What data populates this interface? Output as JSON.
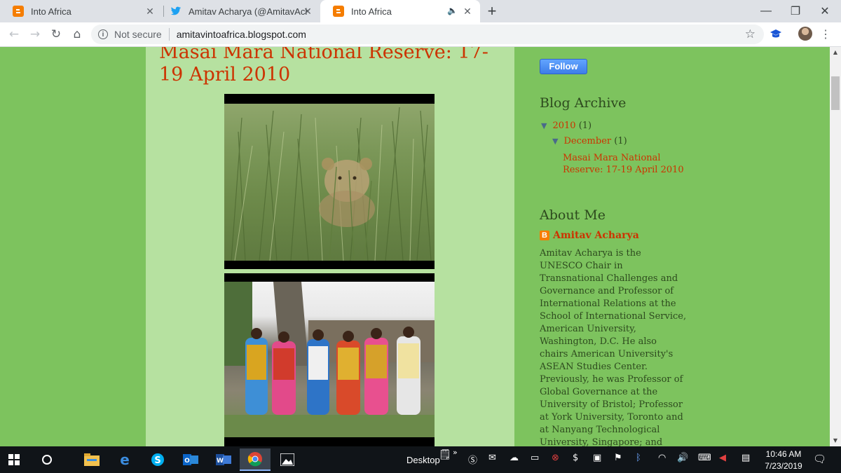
{
  "browser": {
    "tabs": [
      {
        "title": "Into Africa",
        "active": false
      },
      {
        "title": "Amitav Acharya (@AmitavAchary",
        "active": false
      },
      {
        "title": "Into Africa",
        "active": true
      }
    ],
    "new_tab_label": "+",
    "security_label": "Not secure",
    "url": "amitavintoafrica.blogspot.com"
  },
  "post": {
    "title": "Masai Mara National Reserve: 17-19 April 2010"
  },
  "sidebar": {
    "follow_label": "Follow",
    "archive_heading": "Blog Archive",
    "archive_year": "2010",
    "archive_year_count": "(1)",
    "archive_month": "December",
    "archive_month_count": "(1)",
    "archive_post": "Masai Mara National Reserve: 17-19 April 2010",
    "about_heading": "About Me",
    "profile_name": "Amitav Acharya",
    "about_text": "Amitav Acharya is the UNESCO Chair in Transnational Challenges and Governance and Professor of International Relations at the School of International Service, American University, Washington, D.C. He also chairs American University's ASEAN Studies Center. Previously, he was Professor of Global Governance at the University of Bristol; Professor at York University, Toronto and at Nanyang Technological University, Singapore; and Fellow of the Harvard University Asia Center and Fellow of Harvard's John F."
  },
  "taskbar": {
    "desktop_label": "Desktop",
    "time": "10:46 AM",
    "date": "7/23/2019"
  },
  "colors": {
    "page_bg": "#7dc35e",
    "main_bg": "#b6e1a0",
    "link": "#cc3300",
    "heading": "#2d4a1e"
  }
}
